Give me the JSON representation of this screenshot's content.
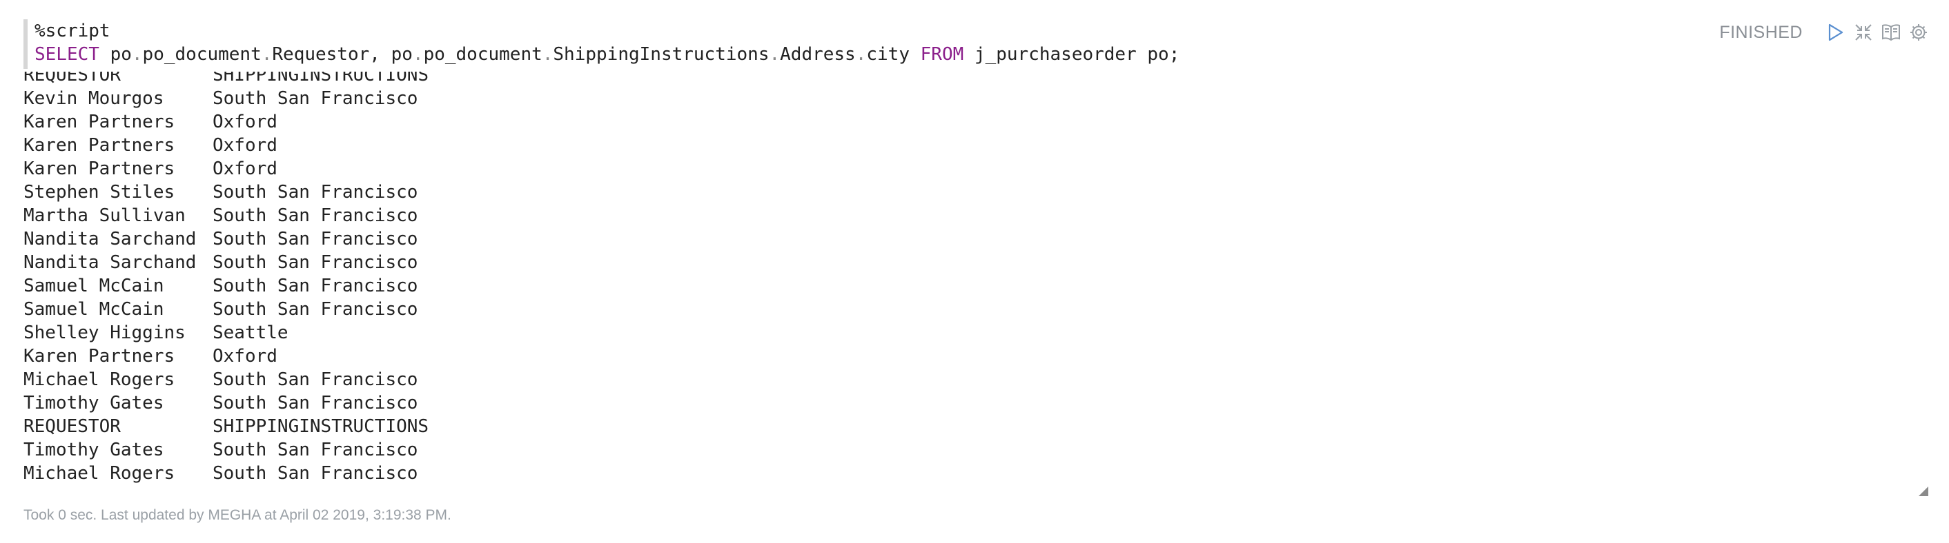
{
  "paragraph": {
    "code_line1": "%script",
    "code_keyword_select": "SELECT",
    "code_cols": [
      {
        "a": "po",
        "b": "po_document",
        "c": "Requestor"
      },
      {
        "a": "po",
        "b": "po_document",
        "c": "ShippingInstructions",
        "d": "Address",
        "e": "city"
      }
    ],
    "code_keyword_from": "FROM",
    "code_table": "j_purchaseorder po;"
  },
  "toolbar": {
    "status": "FINISHED",
    "icons": [
      "run-icon",
      "collapse-icon",
      "book-icon",
      "gear-icon"
    ]
  },
  "results": {
    "rows": [
      [
        "REQUESTOR",
        "SHIPPINGINSTRUCTIONS"
      ],
      [
        "Kevin Mourgos",
        "South San Francisco"
      ],
      [
        "Karen Partners",
        "Oxford"
      ],
      [
        "Karen Partners",
        "Oxford"
      ],
      [
        "Karen Partners",
        "Oxford"
      ],
      [
        "Stephen Stiles",
        "South San Francisco"
      ],
      [
        "Martha Sullivan",
        "South San Francisco"
      ],
      [
        "Nandita Sarchand",
        "South San Francisco"
      ],
      [
        "Nandita Sarchand",
        "South San Francisco"
      ],
      [
        "Samuel McCain",
        "South San Francisco"
      ],
      [
        "Samuel McCain",
        "South San Francisco"
      ],
      [
        "Shelley Higgins",
        "Seattle"
      ],
      [
        "Karen Partners",
        "Oxford"
      ],
      [
        "Michael Rogers",
        "South San Francisco"
      ],
      [
        "Timothy Gates",
        "South San Francisco"
      ],
      [
        "REQUESTOR",
        "SHIPPINGINSTRUCTIONS"
      ],
      [
        "Timothy Gates",
        "South San Francisco"
      ],
      [
        "Michael Rogers",
        "South San Francisco"
      ]
    ]
  },
  "footer": {
    "text": "Took 0 sec. Last updated by MEGHA at April 02 2019, 3:19:38 PM."
  },
  "colors": {
    "keyword": "#8b1f8b",
    "status": "#8a8f95",
    "icon": "#9aa0a6",
    "footer": "#9aa0a6"
  }
}
